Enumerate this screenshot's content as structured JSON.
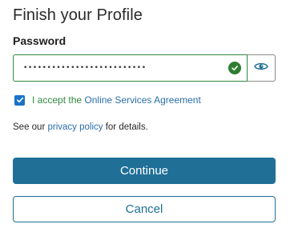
{
  "page": {
    "title": "Finish your Profile"
  },
  "password": {
    "label": "Password",
    "masked_value": "••••••••••••••••••••••••••",
    "valid": true,
    "valid_icon": "check-circle-icon",
    "toggle_icon": "eye-icon"
  },
  "agreement": {
    "checked": true,
    "prefix": "I accept the",
    "link_text": "Online Services Agreement"
  },
  "privacy": {
    "prefix": "See our",
    "link_text": "privacy policy",
    "suffix": "for details."
  },
  "buttons": {
    "continue_label": "Continue",
    "cancel_label": "Cancel"
  },
  "colors": {
    "primary": "#1f6f97",
    "success": "#2e7d32",
    "link": "#2a6fa8",
    "checkbox": "#1a73c8"
  }
}
